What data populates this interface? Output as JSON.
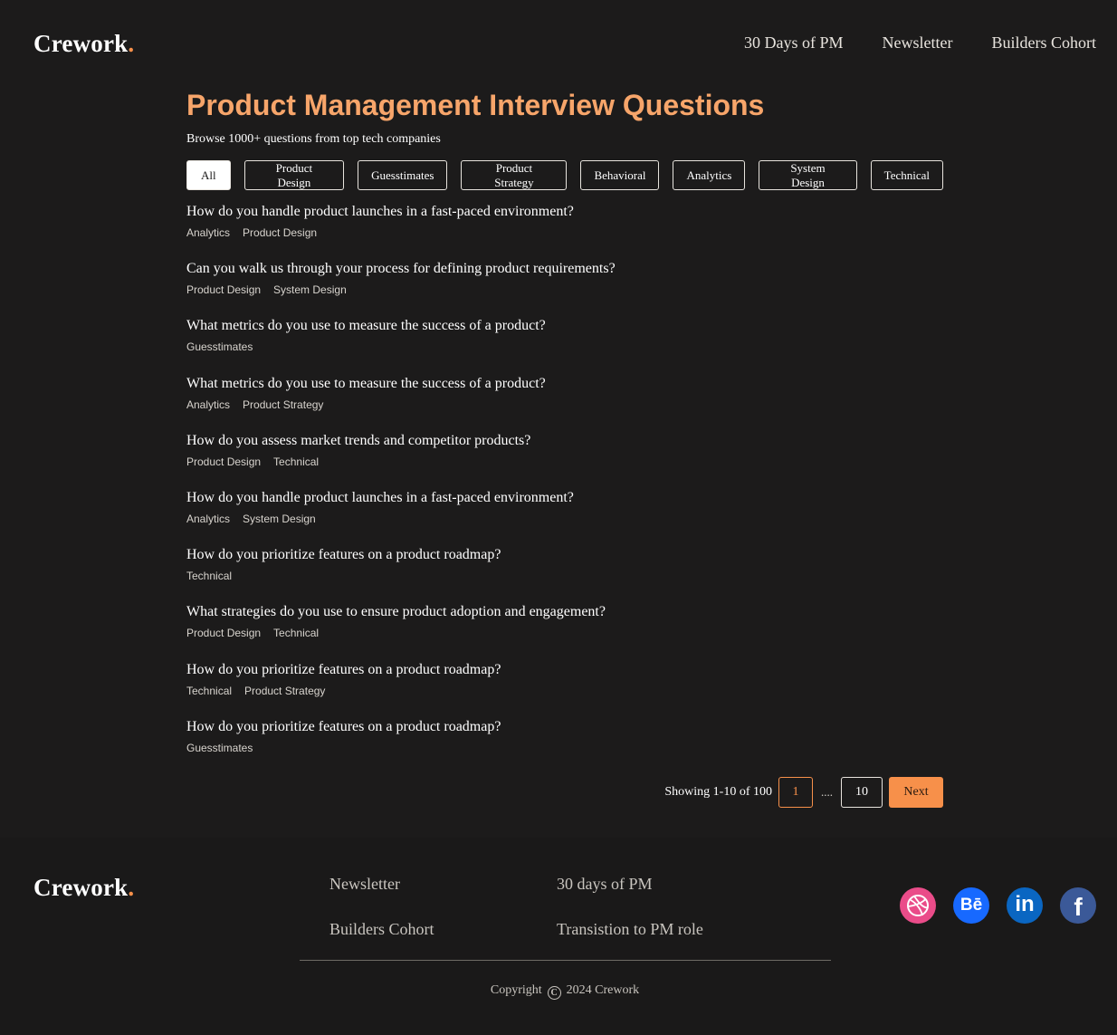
{
  "brand": {
    "name": "Crework",
    "dot": ".",
    "accent": "#f7904a"
  },
  "nav": {
    "items": [
      "30 Days of PM",
      "Newsletter",
      "Builders Cohort"
    ]
  },
  "page": {
    "title": "Product Management Interview Questions",
    "subtitle": "Browse 1000+ questions from top tech companies"
  },
  "filters": {
    "active": "All",
    "items": [
      "All",
      "Product Design",
      "Guesstimates",
      "Product Strategy",
      "Behavioral",
      "Analytics",
      "System Design",
      "Technical"
    ]
  },
  "questions": [
    {
      "title": "How do you handle product launches in a fast-paced environment?",
      "tags": [
        "Analytics",
        "Product Design"
      ]
    },
    {
      "title": "Can you walk us through your process for defining product requirements?",
      "tags": [
        "Product Design",
        "System Design"
      ]
    },
    {
      "title": "What metrics do you use to measure the success of a product?",
      "tags": [
        "Guesstimates"
      ]
    },
    {
      "title": "What metrics do you use to measure the success of a product?",
      "tags": [
        "Analytics",
        "Product Strategy"
      ]
    },
    {
      "title": "How do you assess market trends and competitor products?",
      "tags": [
        "Product Design",
        "Technical"
      ]
    },
    {
      "title": "How do you handle product launches in a fast-paced environment?",
      "tags": [
        "Analytics",
        "System Design"
      ]
    },
    {
      "title": "How do you prioritize features on a product roadmap?",
      "tags": [
        "Technical"
      ]
    },
    {
      "title": "What strategies do you use to ensure product adoption and engagement?",
      "tags": [
        "Product Design",
        "Technical"
      ]
    },
    {
      "title": "How do you prioritize features on a product roadmap?",
      "tags": [
        "Technical",
        "Product Strategy"
      ]
    },
    {
      "title": "How do you prioritize features on a product roadmap?",
      "tags": [
        "Guesstimates"
      ]
    }
  ],
  "pagination": {
    "showing": "Showing 1-10 of 100",
    "current": "1",
    "ellipsis": "....",
    "last": "10",
    "next": "Next"
  },
  "footer": {
    "col1": [
      "Newsletter",
      "Builders Cohort"
    ],
    "col2": [
      "30 days of PM",
      "Transistion to PM role"
    ],
    "copyright_prefix": "Copyright",
    "copyright_symbol": "C",
    "copyright_suffix": "2024 Crework",
    "social": [
      {
        "icon": "dribbble-icon",
        "color": "#ea4c89"
      },
      {
        "icon": "behance-icon",
        "color": "#1769ff",
        "glyph": "Bē"
      },
      {
        "icon": "linkedin-icon",
        "color": "#0a66c2",
        "glyph": "in"
      },
      {
        "icon": "facebook-icon",
        "color": "#3b5998",
        "glyph": "f"
      }
    ]
  }
}
